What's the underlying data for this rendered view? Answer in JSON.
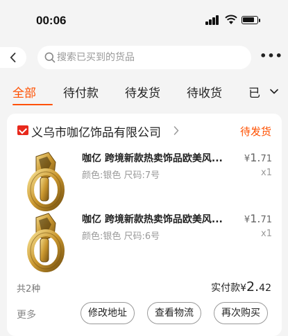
{
  "status_bar": {
    "time": "00:06"
  },
  "search": {
    "placeholder": "搜索已买到的货品",
    "more_label": "•••"
  },
  "tabs": [
    {
      "label": "全部",
      "active": true
    },
    {
      "label": "待付款"
    },
    {
      "label": "待发货"
    },
    {
      "label": "待收货"
    },
    {
      "label": "已"
    }
  ],
  "order": {
    "shop_name": "义乌市咖亿饰品有限公司",
    "status": "待发货",
    "items": [
      {
        "title": "咖亿 跨境新款热卖饰品欧美风...",
        "spec": "颜色:银色 尺码:7号",
        "price_symbol": "¥",
        "price_int": "1.",
        "price_dec": "71",
        "qty": "x1"
      },
      {
        "title": "咖亿 跨境新款热卖饰品欧美风...",
        "spec": "颜色:银色 尺码:6号",
        "price_symbol": "¥",
        "price_int": "1.",
        "price_dec": "71",
        "qty": "x1"
      }
    ],
    "kind_count": "共2种",
    "paid_label": "实付款",
    "paid_symbol": "¥",
    "paid_int": "2.",
    "paid_dec": "42",
    "more_label": "更多",
    "actions": [
      "修改地址",
      "查看物流",
      "再次购买"
    ]
  },
  "colors": {
    "accent": "#ff5000",
    "shop_icon": "#e8291c",
    "background": "#f4f4f4"
  }
}
